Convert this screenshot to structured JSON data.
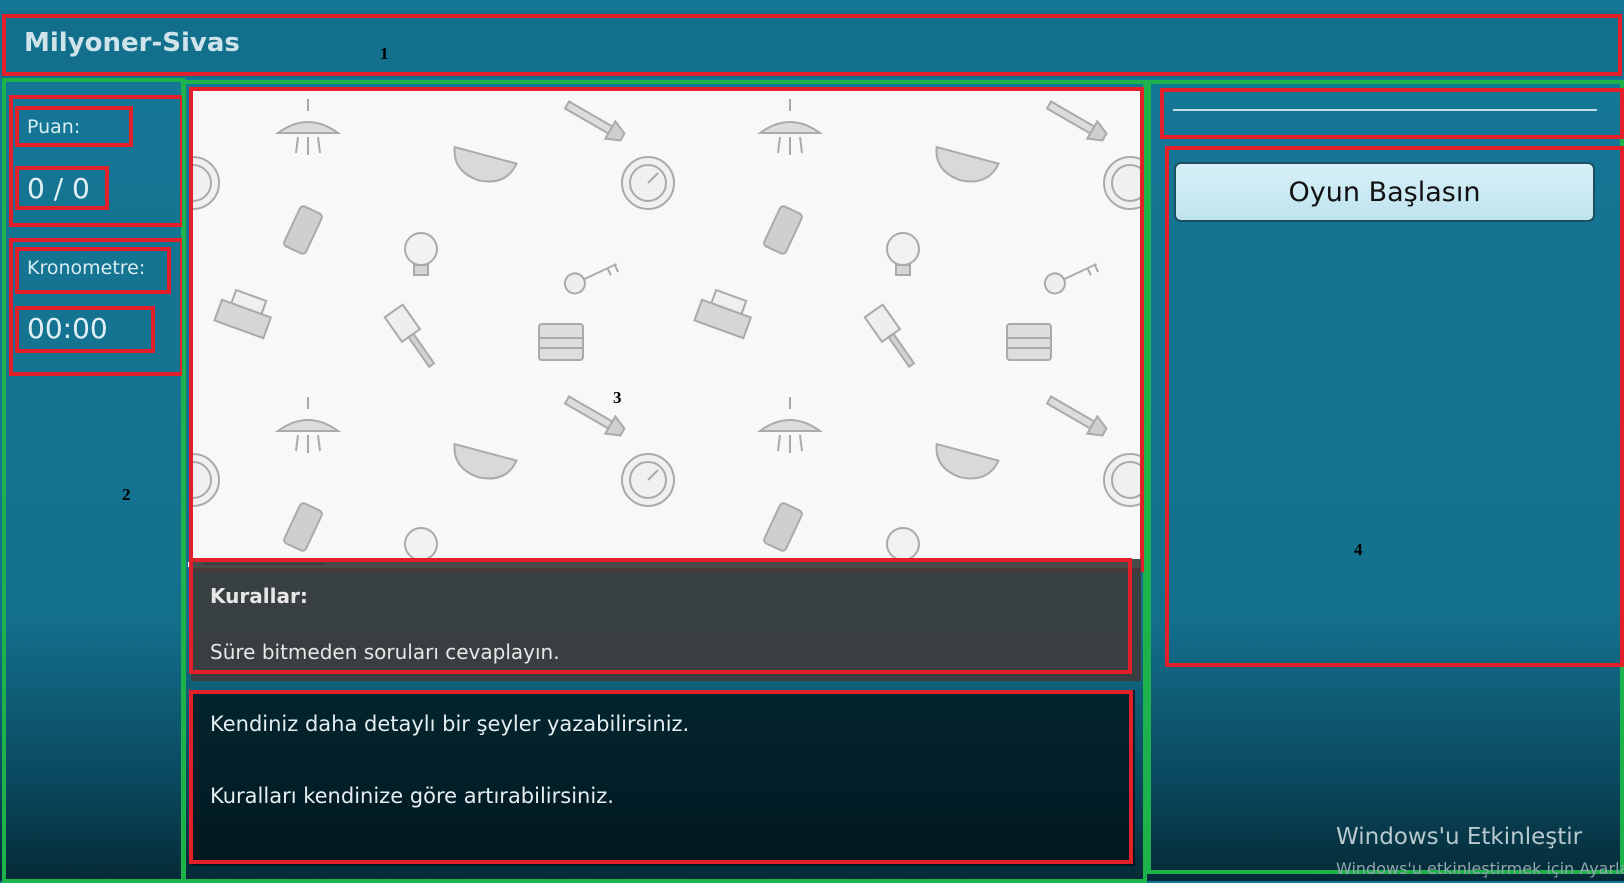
{
  "app": {
    "title": "Milyoner-Sivas"
  },
  "markers": {
    "m1": "1",
    "m2": "2",
    "m3": "3",
    "m4": "4"
  },
  "score": {
    "label": "Puan:",
    "value": "0 / 0"
  },
  "timer": {
    "label": "Kronometre:",
    "value": "00:00"
  },
  "rules": {
    "heading": "Kurallar:",
    "text": "Süre bitmeden soruları cevaplayın."
  },
  "info": {
    "line1": "Kendiniz daha detaylı bir şeyler yazabilirsiniz.",
    "line2": "Kuralları kendinize göre artırabilirsiniz."
  },
  "actions": {
    "start_label": "Oyun Başlasın"
  },
  "watermark": {
    "title": "Windows'u Etkinleştir",
    "subtitle": "Windows'u etkinleştirmek için Ayarlar"
  },
  "colors": {
    "background": "#147896",
    "annotation_red": "#e3202a",
    "annotation_green": "#1eb34a",
    "button_bg": "#c8e9f2"
  },
  "icons": [
    "shower-icon",
    "pipe-wrench-icon",
    "sink-icon",
    "gauge-icon",
    "phone-icon",
    "lightbulb-icon",
    "key-icon",
    "printer-icon",
    "paintbrush-icon",
    "radiator-icon"
  ]
}
